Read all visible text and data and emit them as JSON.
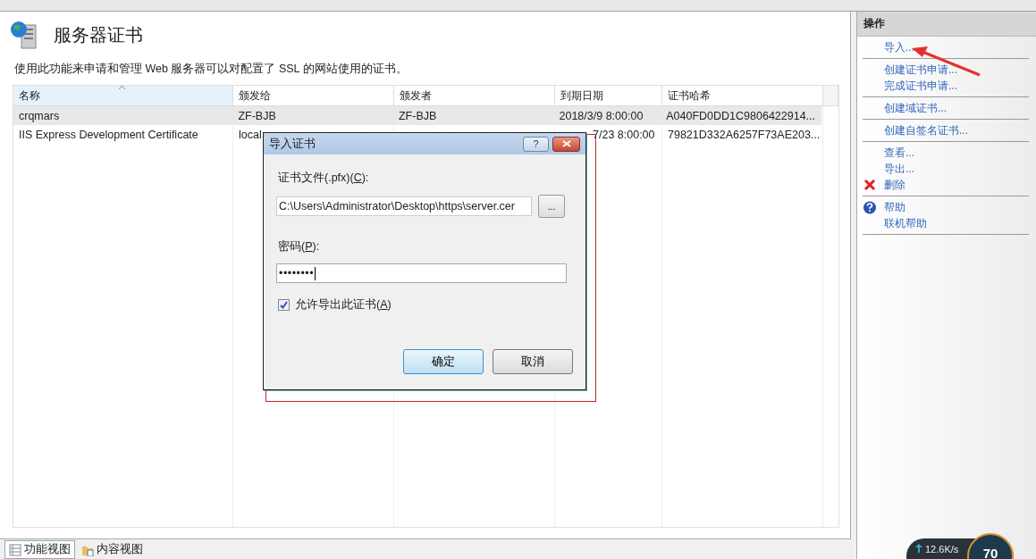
{
  "page": {
    "title": "服务器证书",
    "description": "使用此功能来申请和管理 Web 服务器可以对配置了 SSL 的网站使用的证书。"
  },
  "table": {
    "columns": [
      {
        "label": "名称",
        "sorted": true
      },
      {
        "label": "颁发给",
        "sorted": false
      },
      {
        "label": "颁发者",
        "sorted": false
      },
      {
        "label": "到期日期",
        "sorted": false
      },
      {
        "label": "证书哈希",
        "sorted": false
      }
    ],
    "rows": [
      {
        "selected": true,
        "cells": [
          "crqmars",
          "ZF-BJB",
          "ZF-BJB",
          "2018/3/9 8:00:00",
          "A040FD0DD1C9806422914..."
        ]
      },
      {
        "selected": false,
        "cells": [
          "IIS Express Development Certificate",
          "local",
          "",
          "7/23 8:00:00",
          "79821D332A6257F73AE203..."
        ]
      }
    ]
  },
  "dialog": {
    "title": "导入证书",
    "help_button": "?",
    "file_label": {
      "text": "证书文件(.pfx)(",
      "key": "C",
      "rest": "):"
    },
    "file_value": "C:\\Users\\Administrator\\Desktop\\https\\server.cer",
    "browse_button": "...",
    "password_label": {
      "text": "密码(",
      "key": "P",
      "rest": "):"
    },
    "password_value": "••••••••",
    "allow_export": {
      "text": "允许导出此证书(",
      "key": "A",
      "rest": ")",
      "checked": true
    },
    "buttons": [
      {
        "label": "确定",
        "default": true
      },
      {
        "label": "取消",
        "default": false
      }
    ]
  },
  "actions": {
    "title": "操作",
    "groups": [
      [
        {
          "label": "导入...",
          "kind": "link"
        }
      ],
      [
        {
          "label": "创建证书申请...",
          "kind": "link"
        },
        {
          "label": "完成证书申请...",
          "kind": "link"
        }
      ],
      [
        {
          "label": "创建域证书...",
          "kind": "link"
        }
      ],
      [
        {
          "label": "创建自签名证书...",
          "kind": "link"
        }
      ],
      [
        {
          "label": "查看...",
          "kind": "link"
        },
        {
          "label": "导出...",
          "kind": "link"
        },
        {
          "label": "删除",
          "kind": "delete"
        }
      ],
      [
        {
          "label": "帮助",
          "kind": "help"
        },
        {
          "label": "联机帮助",
          "kind": "link"
        }
      ]
    ]
  },
  "view_tabs": [
    {
      "label": "功能视图",
      "selected": true
    },
    {
      "label": "内容视图",
      "selected": false
    }
  ],
  "net_widget": {
    "speed": "12.6K/s",
    "value": "70"
  }
}
